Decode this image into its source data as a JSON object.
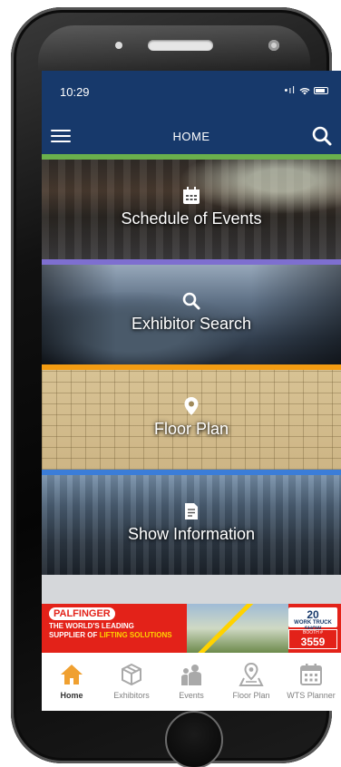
{
  "status_bar": {
    "time": "10:29",
    "signal": "•ıl"
  },
  "header": {
    "title": "HOME"
  },
  "tiles": [
    {
      "label": "Schedule of Events",
      "strip_color": "#6ab04c"
    },
    {
      "label": "Exhibitor Search",
      "strip_color": "#7e6fd0"
    },
    {
      "label": "Floor Plan",
      "strip_color": "#f39c12"
    },
    {
      "label": "Show Information",
      "strip_color": "#3b7dd8"
    }
  ],
  "banner": {
    "brand": "PALFINGER",
    "tagline_line1": "THE WORLD'S LEADING",
    "tagline_line2a": "SUPPLIER OF ",
    "tagline_line2b": "LIFTING SOLUTIONS",
    "logo_top": "20",
    "logo_text": "WORK TRUCK SHOW",
    "booth_label": "BOOTH #",
    "booth_number": "3559"
  },
  "tabs": [
    {
      "label": "Home",
      "icon": "home-icon",
      "active": true
    },
    {
      "label": "Exhibitors",
      "icon": "box-icon",
      "active": false
    },
    {
      "label": "Events",
      "icon": "people-icon",
      "active": false
    },
    {
      "label": "Floor Plan",
      "icon": "map-pin-icon",
      "active": false
    },
    {
      "label": "WTS Planner",
      "icon": "calendar-icon",
      "active": false
    }
  ],
  "colors": {
    "nav_blue": "#17396b",
    "active_tab": "#f0a030",
    "inactive_tab": "#a9a9a9",
    "banner_red": "#e32219"
  }
}
